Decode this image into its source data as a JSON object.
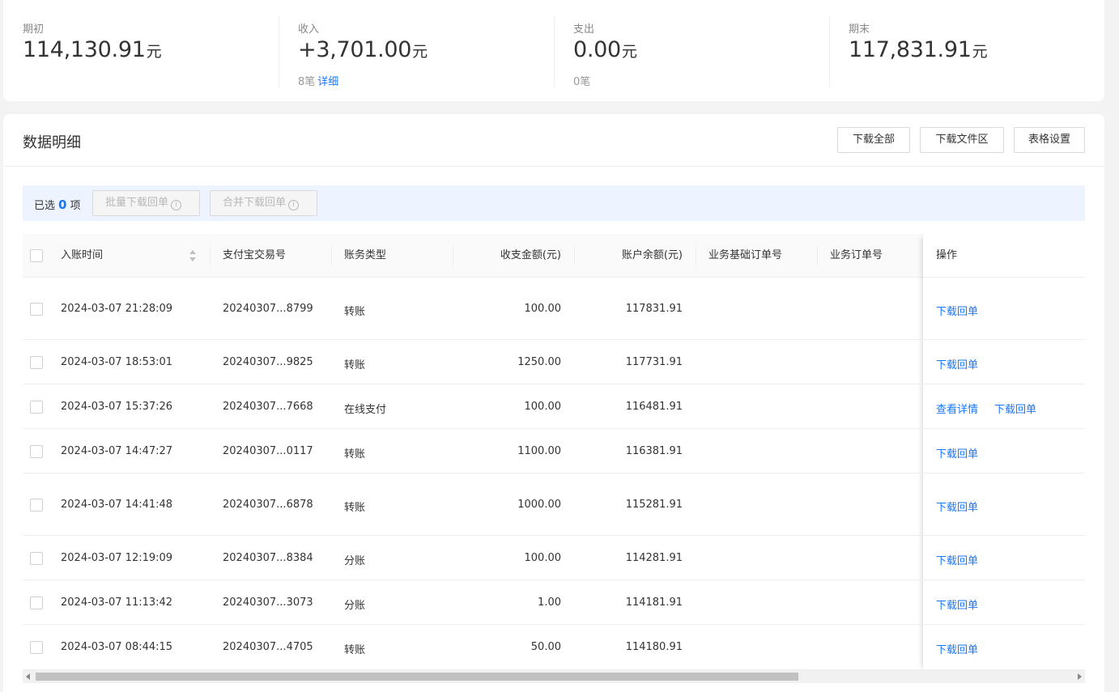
{
  "summary": {
    "opening": {
      "label": "期初",
      "value": "114,130.91",
      "unit": "元"
    },
    "income": {
      "label": "收入",
      "value": "+3,701.00",
      "unit": "元",
      "count": "8笔",
      "detail_link": "详细"
    },
    "expense": {
      "label": "支出",
      "value": "0.00",
      "unit": "元",
      "count": "0笔"
    },
    "closing": {
      "label": "期末",
      "value": "117,831.91",
      "unit": "元"
    }
  },
  "panel": {
    "title": "数据明细",
    "buttons": {
      "download_all": "下载全部",
      "download_area": "下载文件区",
      "table_settings": "表格设置"
    }
  },
  "selection": {
    "prefix": "已选",
    "count": "0",
    "suffix": "项",
    "batch_download": "批量下载回单",
    "merge_download": "合并下载回单",
    "info_glyph": "i"
  },
  "table": {
    "columns": {
      "time": "入账时间",
      "alipay_no": "支付宝交易号",
      "type": "账务类型",
      "amount": "收支金额(元)",
      "balance": "账户余额(元)",
      "base_order": "业务基础订单号",
      "order": "业务订单号",
      "actions": "操作"
    },
    "rows": [
      {
        "time": "2024-03-07 21:28:09",
        "alipay_no": "20240307...8799",
        "type": "转账",
        "amount": "100.00",
        "balance": "117831.91",
        "actions": [
          "下载回单"
        ]
      },
      {
        "time": "2024-03-07 18:53:01",
        "alipay_no": "20240307...9825",
        "type": "转账",
        "amount": "1250.00",
        "balance": "117731.91",
        "actions": [
          "下载回单"
        ]
      },
      {
        "time": "2024-03-07 15:37:26",
        "alipay_no": "20240307...7668",
        "type": "在线支付",
        "amount": "100.00",
        "balance": "116481.91",
        "actions": [
          "查看详情",
          "下载回单"
        ]
      },
      {
        "time": "2024-03-07 14:47:27",
        "alipay_no": "20240307...0117",
        "type": "转账",
        "amount": "1100.00",
        "balance": "116381.91",
        "actions": [
          "下载回单"
        ]
      },
      {
        "time": "2024-03-07 14:41:48",
        "alipay_no": "20240307...6878",
        "type": "转账",
        "amount": "1000.00",
        "balance": "115281.91",
        "actions": [
          "下载回单"
        ]
      },
      {
        "time": "2024-03-07 12:19:09",
        "alipay_no": "20240307...8384",
        "type": "分账",
        "amount": "100.00",
        "balance": "114281.91",
        "actions": [
          "下载回单"
        ]
      },
      {
        "time": "2024-03-07 11:13:42",
        "alipay_no": "20240307...3073",
        "type": "分账",
        "amount": "1.00",
        "balance": "114181.91",
        "actions": [
          "下载回单"
        ]
      },
      {
        "time": "2024-03-07 08:44:15",
        "alipay_no": "20240307...4705",
        "type": "转账",
        "amount": "50.00",
        "balance": "114180.91",
        "actions": [
          "下载回单"
        ]
      }
    ]
  },
  "colors": {
    "accent": "#1677ff",
    "selection_bar": "#edf4ff",
    "page_bg": "#f3f3f3"
  }
}
